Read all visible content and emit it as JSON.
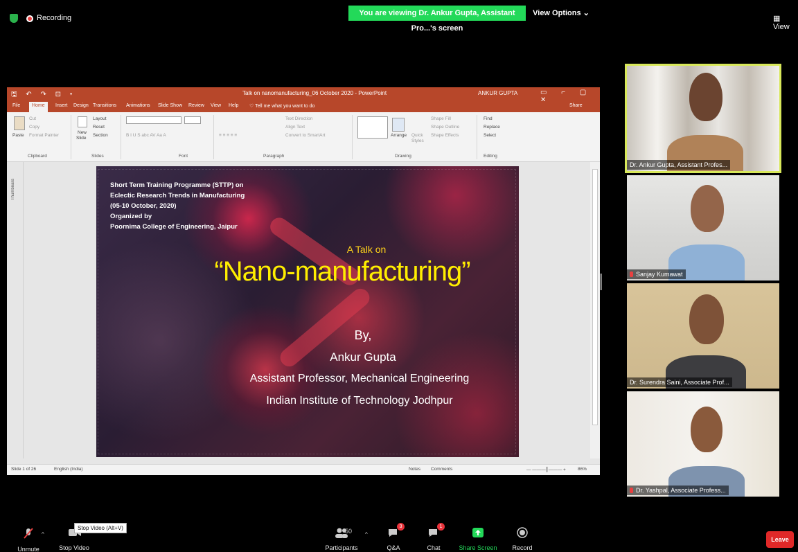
{
  "top_bar": {
    "recording_label": "Recording",
    "viewing_banner": "You are viewing Dr. Ankur Gupta, Assistant Pro...'s screen",
    "view_options_label": "View Options ⌄",
    "view_label": "View"
  },
  "powerpoint": {
    "doc_title": "Talk on nanomanufacturing_06 October 2020  -  PowerPoint",
    "user_name": "ANKUR GUPTA",
    "quick_access": "🖫 ↶ ↷ ⊡ ▾",
    "window_buttons": "▭ ⌐ ▢ ✕",
    "tabs": [
      "File",
      "Home",
      "Insert",
      "Design",
      "Transitions",
      "Animations",
      "Slide Show",
      "Review",
      "View",
      "Help"
    ],
    "tell_me": "Tell me what you want to do",
    "share_label": "Share",
    "ribbon": {
      "paste": "Paste",
      "cut": "Cut",
      "copy": "Copy",
      "format_painter": "Format Painter",
      "new_slide_1": "New",
      "new_slide_2": "Slide",
      "layout": "Layout",
      "reset": "Reset",
      "section": "Section",
      "font_tools": "B  I  U  S  abc  AV  Aa   A",
      "para_tools": "≡  ≡  ≡  ≡  ≡",
      "text_direction": "Text Direction",
      "align_text": "Align Text",
      "convert_smartart": "Convert to SmartArt",
      "arrange": "Arrange",
      "quick_styles_1": "Quick",
      "quick_styles_2": "Styles",
      "shape_fill": "Shape Fill",
      "shape_outline": "Shape Outline",
      "shape_effects": "Shape Effects",
      "find": "Find",
      "replace": "Replace",
      "select": "Select",
      "groups": [
        "Clipboard",
        "Slides",
        "Font",
        "Paragraph",
        "Drawing",
        "Editing"
      ]
    },
    "thumbnails_label": "Thumbnails",
    "status": {
      "slide_count": "Slide 1 of 26",
      "language": "English (India)",
      "notes": "Notes",
      "comments": "Comments",
      "zoom": "86%"
    }
  },
  "slide": {
    "org_lines": [
      "Short Term Training Programme (STTP) on",
      "Eclectic Research Trends in Manufacturing",
      "(05-10 October, 2020)",
      "Organized by",
      "Poornima College of Engineering, Jaipur"
    ],
    "talk_on": "A Talk on",
    "title": "“Nano-manufacturing”",
    "by": "By,",
    "speaker": "Ankur Gupta",
    "designation": "Assistant Professor, Mechanical Engineering",
    "institute": "Indian Institute of Technology Jodhpur"
  },
  "participants_video": [
    {
      "name": "Dr. Ankur Gupta, Assistant Profes...",
      "muted": false,
      "active": true
    },
    {
      "name": "Sanjay Kumawat",
      "muted": true,
      "active": false
    },
    {
      "name": "Dr. Surendra Saini, Associate Prof...",
      "muted": false,
      "active": false
    },
    {
      "name": "Dr. Yashpal, Associate Profess...",
      "muted": true,
      "active": false
    }
  ],
  "toolbar": {
    "unmute": "Unmute",
    "stop_video": "Stop Video",
    "tooltip": "Stop Video (Alt+V)",
    "participants": "Participants",
    "participants_count": "50",
    "qa": "Q&A",
    "qa_badge": "3",
    "chat": "Chat",
    "chat_badge": "1",
    "share_screen": "Share Screen",
    "record": "Record",
    "leave": "Leave",
    "share_color": "#23d959",
    "leave_color": "#e02828"
  }
}
